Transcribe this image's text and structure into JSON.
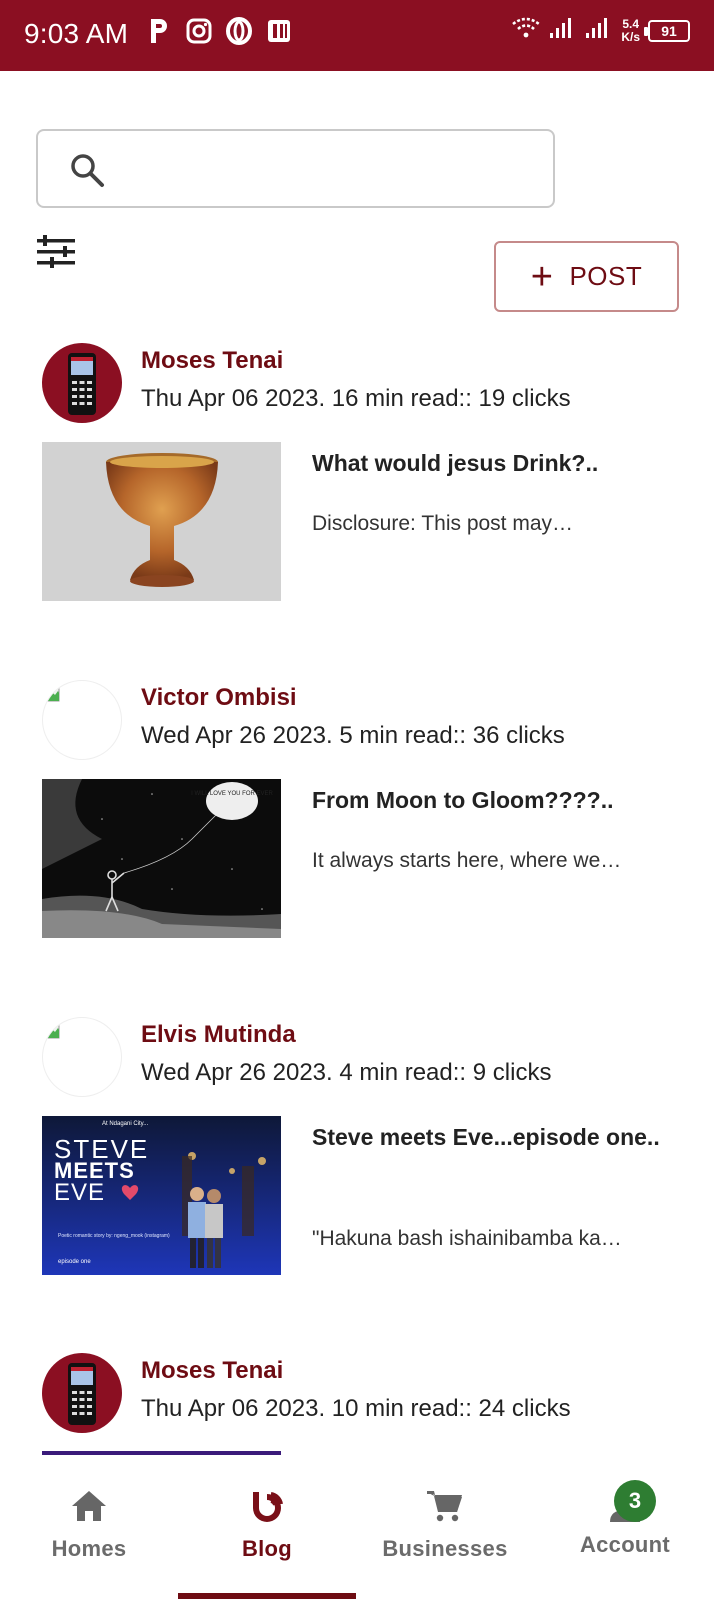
{
  "status_bar": {
    "time": "9:03 AM",
    "net_speed_value": "5.4",
    "net_speed_unit": "K/s",
    "battery": "91"
  },
  "search": {
    "placeholder": ""
  },
  "actions": {
    "post_label": "POST"
  },
  "posts": [
    {
      "author": "Moses Tenai",
      "meta": "Thu Apr 06 2023. 16 min read:: 19 clicks",
      "title": "What would jesus Drink?..",
      "excerpt": "Disclosure: This post may…"
    },
    {
      "author": "Victor Ombisi",
      "meta": "Wed Apr 26 2023. 5 min read:: 36 clicks",
      "title": "From Moon to Gloom????..",
      "excerpt": "It always starts here, where we…",
      "thumb_text": "I WILL LOVE YOU FOR EVER"
    },
    {
      "author": "Elvis Mutinda",
      "meta": "Wed Apr 26 2023. 4 min read:: 9 clicks",
      "title": "Steve meets Eve...episode one..",
      "excerpt": "\"Hakuna bash ishainibamba ka…",
      "thumb": {
        "top_line": "At Ndagani City...",
        "line1": "STEVE",
        "line2": "MEETS",
        "line3": "EVE",
        "caption": "Poetic romantic story by: ngeng_mook (instagram)",
        "footer": "episode one"
      }
    },
    {
      "author": "Moses Tenai",
      "meta": "Thu Apr 06 2023. 10 min read:: 24 clicks"
    }
  ],
  "bottom_nav": {
    "items": [
      {
        "label": "Homes",
        "icon": "home-icon"
      },
      {
        "label": "Blog",
        "icon": "blog-icon"
      },
      {
        "label": "Businesses",
        "icon": "cart-icon"
      },
      {
        "label": "Account",
        "icon": "account-icon"
      }
    ],
    "account_badge": "3",
    "active": "Blog"
  },
  "colors": {
    "brand": "#8b0f22",
    "accent_text": "#6e0c13",
    "badge": "#2e7d32"
  }
}
